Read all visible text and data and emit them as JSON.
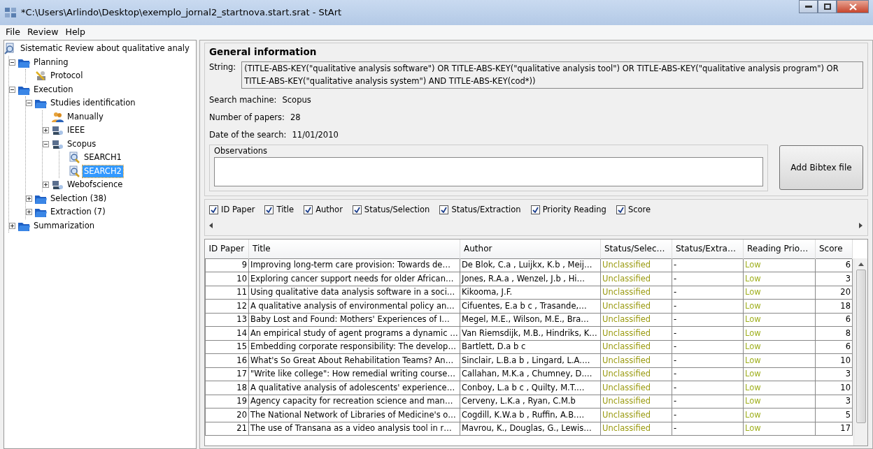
{
  "window": {
    "title": "*C:\\Users\\Arlindo\\Desktop\\exemplo_jornal2_startnova.start.srat - StArt"
  },
  "menu": [
    "File",
    "Review",
    "Help"
  ],
  "tree": {
    "label": "Sistematic Review about qualitative analy",
    "kind": "review",
    "children": [
      {
        "label": "Planning",
        "kind": "folder",
        "expanded": true,
        "selected": false,
        "children": [
          {
            "label": "Protocol",
            "kind": "protocol",
            "selected": false
          }
        ]
      },
      {
        "label": "Execution",
        "kind": "folder",
        "expanded": true,
        "selected": false,
        "children": [
          {
            "label": "Studies identification",
            "kind": "folder",
            "expanded": true,
            "selected": false,
            "children": [
              {
                "label": "Manually",
                "kind": "people",
                "selected": false
              },
              {
                "label": "IEEE",
                "kind": "engine",
                "expanded": false,
                "selected": false
              },
              {
                "label": "Scopus",
                "kind": "engine",
                "expanded": true,
                "selected": false,
                "children": [
                  {
                    "label": "SEARCH1",
                    "kind": "search",
                    "selected": false
                  },
                  {
                    "label": "SEARCH2",
                    "kind": "search",
                    "selected": true
                  }
                ]
              },
              {
                "label": "Webofscience",
                "kind": "engine",
                "expanded": false,
                "selected": false
              }
            ]
          },
          {
            "label": "Selection (38)",
            "kind": "folder",
            "expanded": false,
            "selected": false
          },
          {
            "label": "Extraction (7)",
            "kind": "folder",
            "expanded": false,
            "selected": false
          }
        ]
      },
      {
        "label": "Summarization",
        "kind": "folder",
        "expanded": false,
        "selected": false
      }
    ]
  },
  "general": {
    "heading": "General information",
    "string_label": "String:",
    "string": "(TITLE-ABS-KEY(\"qualitative analysis software\") OR TITLE-ABS-KEY(\"qualitative analysis tool\") OR TITLE-ABS-KEY(\"qualitative analysis program\") OR TITLE-ABS-KEY(\"qualitative analysis system\") AND TITLE-ABS-KEY(cod*))",
    "fields": [
      {
        "label": "Search machine:",
        "value": "Scopus"
      },
      {
        "label": "Number of papers:",
        "value": "28"
      },
      {
        "label": "Date of the search:",
        "value": "11/01/2010"
      }
    ],
    "observations_label": "Observations",
    "add_button": "Add Bibtex file"
  },
  "column_toggles": [
    {
      "label": "ID Paper",
      "checked": true
    },
    {
      "label": "Title",
      "checked": true
    },
    {
      "label": "Author",
      "checked": true
    },
    {
      "label": "Status/Selection",
      "checked": true
    },
    {
      "label": "Status/Extraction",
      "checked": true
    },
    {
      "label": "Priority Reading",
      "checked": true
    },
    {
      "label": "Score",
      "checked": true
    }
  ],
  "table": {
    "columns": [
      "ID Paper",
      "Title",
      "Author",
      "Status/Selec…",
      "Status/Extra…",
      "Reading Prio…",
      "Score"
    ],
    "rows": [
      [
        "9",
        "Improving long-term care provision: Towards de…",
        "De Blok, C.a , Luijkx, K.b , Meij…",
        "Unclassified",
        "-",
        "Low",
        "6"
      ],
      [
        "10",
        "Exploring cancer support needs for older African…",
        "Jones, R.A.a , Wenzel, J.b , Hi…",
        "Unclassified",
        "-",
        "Low",
        "3"
      ],
      [
        "11",
        "Using qualitative data analysis software in a soci…",
        "Kikooma, J.F.",
        "Unclassified",
        "-",
        "Low",
        "20"
      ],
      [
        "12",
        "A qualitative analysis of environmental policy an…",
        "Cifuentes, E.a  b  c , Trasande,…",
        "Unclassified",
        "-",
        "Low",
        "18"
      ],
      [
        "13",
        "Baby Lost and Found: Mothers' Experiences of I…",
        "Megel, M.E., Wilson, M.E., Bra…",
        "Unclassified",
        "-",
        "Low",
        "6"
      ],
      [
        "14",
        "An empirical study of agent programs a dynamic …",
        "Van Riemsdijk, M.B., Hindriks, K…",
        "Unclassified",
        "-",
        "Low",
        "8"
      ],
      [
        "15",
        "Embedding corporate responsibility: The develop…",
        "Bartlett, D.a  b  c",
        "Unclassified",
        "-",
        "Low",
        "6"
      ],
      [
        "16",
        "What's So Great About Rehabilitation Teams? An…",
        "Sinclair, L.B.a  b , Lingard, L.A.…",
        "Unclassified",
        "-",
        "Low",
        "10"
      ],
      [
        "17",
        "\"Write like college\": How remedial writing course…",
        "Callahan, M.K.a , Chumney, D.…",
        "Unclassified",
        "-",
        "Low",
        "3"
      ],
      [
        "18",
        "A qualitative analysis of adolescents' experience…",
        "Conboy, L.a  b  c , Quilty, M.T.…",
        "Unclassified",
        "-",
        "Low",
        "10"
      ],
      [
        "19",
        "Agency capacity for recreation science and man…",
        "Cerveny, L.K.a , Ryan, C.M.b",
        "Unclassified",
        "-",
        "Low",
        "3"
      ],
      [
        "20",
        "The National Network of Libraries of Medicine's o…",
        "Cogdill, K.W.a  b , Ruffin, A.B.…",
        "Unclassified",
        "-",
        "Low",
        "5"
      ],
      [
        "21",
        "The use of Transana as a video analysis tool in r…",
        "Mavrou, K., Douglas, G., Lewis…",
        "Unclassified",
        "-",
        "Low",
        "17"
      ]
    ]
  }
}
